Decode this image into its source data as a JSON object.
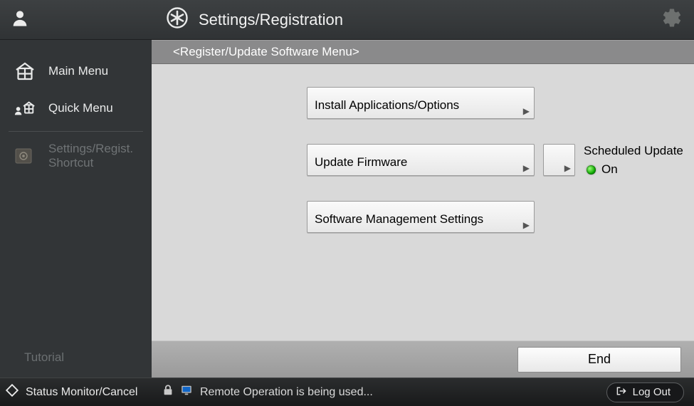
{
  "header": {
    "title": "Settings/Registration"
  },
  "breadcrumb": "<Register/Update Software Menu>",
  "sidebar": {
    "items": [
      {
        "label": "Main Menu"
      },
      {
        "label": "Quick Menu"
      },
      {
        "label": "Settings/Regist. Shortcut"
      }
    ],
    "tutorial_label": "Tutorial"
  },
  "buttons": {
    "install": "Install Applications/Options",
    "update_fw": "Update Firmware",
    "sw_mgmt": "Software Management Settings",
    "end": "End"
  },
  "scheduled": {
    "label": "Scheduled Update",
    "status": "On"
  },
  "statusbar": {
    "monitor": "Status Monitor/Cancel",
    "message": "Remote Operation is being used...",
    "logout": "Log Out"
  }
}
